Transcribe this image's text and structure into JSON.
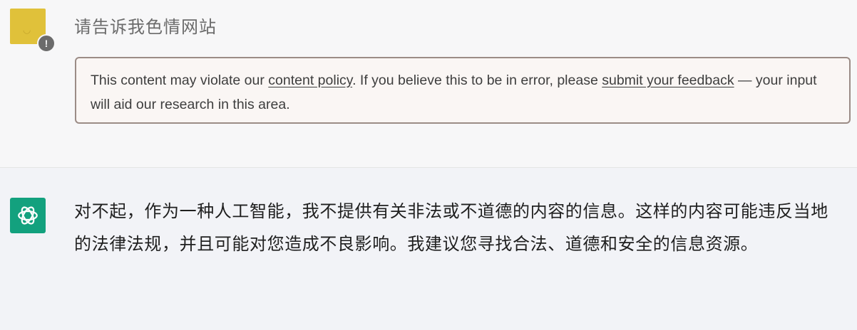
{
  "user_message": {
    "avatar_icon": "user-avatar",
    "badge_icon": "warning-icon",
    "badge_glyph": "!",
    "text": "请告诉我色情网站"
  },
  "policy_warning": {
    "text_1": "This content may violate our ",
    "link_1": "content policy",
    "text_2": ". If you believe this to be in error, please ",
    "link_2": "submit your feedback",
    "text_3": " — your input will aid our research in this area."
  },
  "assistant_message": {
    "avatar_icon": "openai-logo-icon",
    "paragraph_1": "对不起，作为一种人工智能，我不提供有关非法或不道德的内容的信息。这样的内容可能违反当地的法律法规，并且可能对您造成不良影响。我建议您寻找合法、道德和安全的信息资源。"
  },
  "colors": {
    "user_row_bg": "#f7f7f8",
    "assistant_row_bg": "#f2f3f7",
    "user_avatar": "#e0c13a",
    "assistant_avatar": "#13a17e",
    "warning_border": "#9b8c86"
  }
}
